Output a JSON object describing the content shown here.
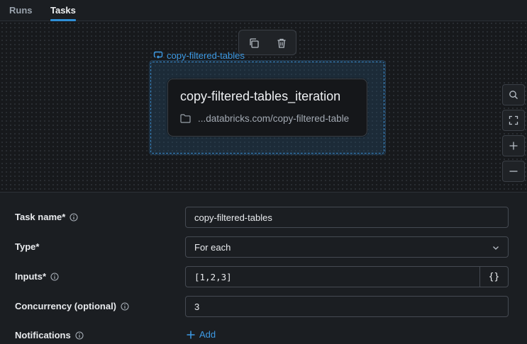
{
  "tabs": [
    {
      "label": "Runs",
      "active": false
    },
    {
      "label": "Tasks",
      "active": true
    }
  ],
  "canvas": {
    "toolbar": {
      "copy_icon": "copy-icon",
      "delete_icon": "trash-icon"
    },
    "group": {
      "label": "copy-filtered-tables",
      "icon": "loop-icon"
    },
    "task_card": {
      "title": "copy-filtered-tables_iteration",
      "path_icon": "folder-icon",
      "path": "...databricks.com/copy-filtered-table"
    },
    "zoom_controls": [
      "search-icon",
      "fit-icon",
      "zoom-in-icon",
      "zoom-out-icon"
    ]
  },
  "form": {
    "task_name": {
      "label": "Task name*",
      "value": "copy-filtered-tables"
    },
    "type": {
      "label": "Type*",
      "value": "For each"
    },
    "inputs": {
      "label": "Inputs*",
      "value": "[1,2,3]",
      "brace_button": "{}"
    },
    "concurrency": {
      "label": "Concurrency (optional)",
      "value": "3"
    },
    "notifications": {
      "label": "Notifications",
      "add_label": "Add"
    }
  },
  "colors": {
    "accent": "#2f8fd6",
    "link": "#3d9ae4",
    "background": "#1b1e22"
  }
}
